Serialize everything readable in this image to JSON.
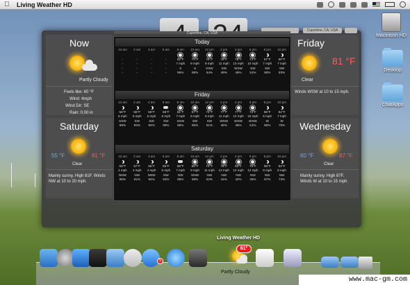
{
  "menubar": {
    "app_name": "Living Weather HD"
  },
  "desktop": {
    "icons": [
      {
        "label": "Macintosh HD"
      },
      {
        "label": "Desktop"
      },
      {
        "label": "ChatApps"
      }
    ]
  },
  "clock": {
    "hour": "4",
    "minute": "24"
  },
  "location": "Cupertino, CA, USA",
  "now": {
    "title": "Now",
    "condition": "Partly Cloudy",
    "feels_like": "Feels like: 60 °F",
    "wind": "Wind: 4mph",
    "wind_dir": "Wind Dir: SE",
    "rain": "Rain: 0.00 in"
  },
  "today": {
    "title": "Friday",
    "temp": "81 °F",
    "condition": "Clear",
    "summary": "Winds WSW at 10 to 15 mph."
  },
  "saturday": {
    "title": "Saturday",
    "low": "55 °F",
    "high": "81 °F",
    "condition": "Clear",
    "summary": "Mainly sunny. High 81F. Winds NW at 10 to 20 mph."
  },
  "wednesday": {
    "title": "Wednesday",
    "low": "60 °F",
    "high": "87 °F",
    "condition": "Clear",
    "summary": "Mainly sunny. High 87F. Winds W at 10 to 15 mph."
  },
  "hourly": {
    "header": "Cupertino, CA, USA",
    "sections": [
      {
        "title": "Today",
        "hours": [
          {
            "time": "12 am",
            "icon": "none",
            "temp": "-",
            "wind": "-",
            "dir": "-",
            "pct": "-"
          },
          {
            "time": "2 am",
            "icon": "none",
            "temp": "-",
            "wind": "-",
            "dir": "-",
            "pct": "-"
          },
          {
            "time": "4 am",
            "icon": "none",
            "temp": "-",
            "wind": "-",
            "dir": "-",
            "pct": "-"
          },
          {
            "time": "6 am",
            "icon": "none",
            "temp": "-",
            "wind": "-",
            "dir": "-",
            "pct": "-"
          },
          {
            "time": "8 am",
            "icon": "sun",
            "temp": "62°F",
            "wind": "7 mph",
            "dir": "S",
            "pct": "96%"
          },
          {
            "time": "10 am",
            "icon": "sun",
            "temp": "70°F",
            "wind": "8 mph",
            "dir": "S",
            "pct": "68%"
          },
          {
            "time": "12 pm",
            "icon": "sun",
            "temp": "76°F",
            "wind": "9 mph",
            "dir": "SSW",
            "pct": "54%"
          },
          {
            "time": "2 pm",
            "icon": "sun",
            "temp": "79°F",
            "wind": "11 mph",
            "dir": "SW",
            "pct": "48%"
          },
          {
            "time": "4 pm",
            "icon": "sun",
            "temp": "79°F",
            "wind": "13 mph",
            "dir": "WSW",
            "pct": "46%"
          },
          {
            "time": "6 pm",
            "icon": "sun",
            "temp": "74°F",
            "wind": "10 mph",
            "dir": "SW",
            "pct": "51%"
          },
          {
            "time": "8 pm",
            "icon": "moon",
            "temp": "67°F",
            "wind": "7 mph",
            "dir": "SW",
            "pct": "68%"
          },
          {
            "time": "10 pm",
            "icon": "moon",
            "temp": "60°F",
            "wind": "7 mph",
            "dir": "SW",
            "pct": "83%"
          }
        ]
      },
      {
        "title": "Friday",
        "hours": [
          {
            "time": "12 am",
            "icon": "moon",
            "temp": "58°F",
            "wind": "5 mph",
            "dir": "SSW",
            "pct": "89%"
          },
          {
            "time": "2 am",
            "icon": "moon",
            "temp": "56°F",
            "wind": "5 mph",
            "dir": "SW",
            "pct": "94%"
          },
          {
            "time": "4 am",
            "icon": "moon",
            "temp": "56°F",
            "wind": "5 mph",
            "dir": "SW",
            "pct": "94%"
          },
          {
            "time": "6 am",
            "icon": "cloud",
            "temp": "56°F",
            "wind": "6 mph",
            "dir": "SW",
            "pct": "96%"
          },
          {
            "time": "8 am",
            "icon": "sun",
            "temp": "61°F",
            "wind": "7 mph",
            "dir": "SSW",
            "pct": "85%"
          },
          {
            "time": "10 am",
            "icon": "sun",
            "temp": "67°F",
            "wind": "9 mph",
            "dir": "SW",
            "pct": "65%"
          },
          {
            "time": "12 pm",
            "icon": "sun",
            "temp": "74°F",
            "wind": "9 mph",
            "dir": "SW",
            "pct": "51%"
          },
          {
            "time": "2 pm",
            "icon": "sun",
            "temp": "77°F",
            "wind": "11 mph",
            "dir": "WSW",
            "pct": "46%"
          },
          {
            "time": "4 pm",
            "icon": "sun",
            "temp": "77°F",
            "wind": "12 mph",
            "dir": "WSW",
            "pct": "46%"
          },
          {
            "time": "6 pm",
            "icon": "sun",
            "temp": "73°F",
            "wind": "10 mph",
            "dir": "WSW",
            "pct": "51%"
          },
          {
            "time": "8 pm",
            "icon": "moon",
            "temp": "66°F",
            "wind": "8 mph",
            "dir": "W",
            "pct": "66%"
          },
          {
            "time": "10 pm",
            "icon": "moon",
            "temp": "62°F",
            "wind": "7 mph",
            "dir": "W",
            "pct": "76%"
          }
        ]
      },
      {
        "title": "Saturday",
        "hours": [
          {
            "time": "12 am",
            "icon": "moon",
            "temp": "59°F",
            "wind": "4 mph",
            "dir": "NNW",
            "pct": "86%"
          },
          {
            "time": "2 am",
            "icon": "moon",
            "temp": "57°F",
            "wind": "4 mph",
            "dir": "NW",
            "pct": "91%"
          },
          {
            "time": "4 am",
            "icon": "moon",
            "temp": "56°F",
            "wind": "4 mph",
            "dir": "NNW",
            "pct": "94%"
          },
          {
            "time": "6 am",
            "icon": "moon",
            "temp": "55°F",
            "wind": "5 mph",
            "dir": "NW",
            "pct": "94%"
          },
          {
            "time": "8 am",
            "icon": "cloud",
            "temp": "59°F",
            "wind": "7 mph",
            "dir": "NW",
            "pct": "88%"
          },
          {
            "time": "10 am",
            "icon": "sun",
            "temp": "66°F",
            "wind": "9 mph",
            "dir": "NNW",
            "pct": "68%"
          },
          {
            "time": "12 pm",
            "icon": "sun",
            "temp": "74°F",
            "wind": "11 mph",
            "dir": "NW",
            "pct": "52%"
          },
          {
            "time": "2 pm",
            "icon": "sun",
            "temp": "78°F",
            "wind": "12 mph",
            "dir": "NW",
            "pct": "44%"
          },
          {
            "time": "4 pm",
            "icon": "sun",
            "temp": "80°F",
            "wind": "12 mph",
            "dir": "NW",
            "pct": "42%"
          },
          {
            "time": "6 pm",
            "icon": "sun",
            "temp": "76°F",
            "wind": "12 mph",
            "dir": "NW",
            "pct": "46%"
          },
          {
            "time": "8 pm",
            "icon": "moon",
            "temp": "69°F",
            "wind": "9 mph",
            "dir": "NW",
            "pct": "57%"
          },
          {
            "time": "10 pm",
            "icon": "moon",
            "temp": "63°F",
            "wind": "8 mph",
            "dir": "NW",
            "pct": "73%"
          }
        ]
      }
    ]
  },
  "dock": {
    "app_label": "Living Weather HD",
    "badge": "61°",
    "weather_caption": "Partly Cloudy",
    "notification_badge": "5"
  },
  "watermark": "www.mac-gm.com"
}
